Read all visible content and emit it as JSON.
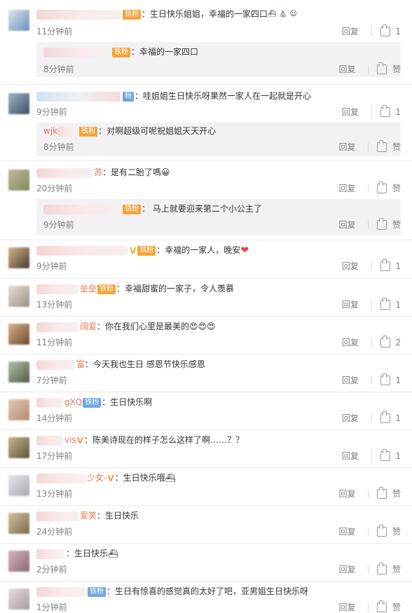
{
  "actions": {
    "reply": "回复",
    "like": "赞"
  },
  "comments": [
    {
      "name_tail": "",
      "badge": "铁粉",
      "text": "：生日快乐姐姐，幸福的一家四口",
      "suffix": "⛴ ⛪ ☺",
      "time": "11分钟前",
      "likes": "1",
      "replies": [
        {
          "name_tail": "",
          "badge": "铁粉",
          "text": "：幸福的一家四口",
          "time": "8分钟前",
          "likes": "赞"
        }
      ]
    },
    {
      "name_tail": "",
      "badge": "粉",
      "text": "：哇姐姐生日快乐呀果然一家人在一起就是开心",
      "time": "9分钟前",
      "likes": "1",
      "replies": [
        {
          "name_tail": "wjk",
          "badge": "铁粉",
          "text": "：对啊超级可呢祝姐姐天天开心",
          "time": "8分钟前",
          "likes": "赞"
        }
      ]
    },
    {
      "name_tail": "苏",
      "text": "：是有二胎了嗎😀",
      "time": "20分钟前",
      "likes": "赞",
      "replies": [
        {
          "name_tail": "",
          "badge": "铁粉",
          "text": "： 马上就要迎来第二个小公主了",
          "time": "9分钟前",
          "likes": "赞"
        }
      ]
    },
    {
      "name_tail": "",
      "badge": "铁粉",
      "vip": "V",
      "text": "：幸福的一家人，晚安",
      "suffix": "❤",
      "time": "9分钟前",
      "likes": "1"
    },
    {
      "name_tail": "垒垒",
      "badge": "铁粉",
      "text": "：幸福甜蜜的一家子，令人羡慕",
      "time": "13分钟前",
      "likes": "1"
    },
    {
      "name_tail": "阔爱",
      "text": "：你在我们心里是最美的😍😍😍",
      "time": "11分钟前",
      "likes": "2"
    },
    {
      "name_tail": "富",
      "text": "：今天我也生日  感恩节快乐感恩",
      "time": "7分钟前",
      "likes": "1"
    },
    {
      "name_tail": "gXQ",
      "badge": "铁粉",
      "text": "：生日快乐啊",
      "time": "14分钟前",
      "likes": "1"
    },
    {
      "name_tail": "vis",
      "vip": "V",
      "text": "：陈美诗现在的样子怎么这样了啊……？？",
      "time": "17分钟前",
      "likes": "1"
    },
    {
      "name_tail": "少女-",
      "vip": "V",
      "text": "：生日快乐哦⛴",
      "time": "13分钟前",
      "likes": "赞"
    },
    {
      "name_tail": "爱笑",
      "text": "：生日快乐",
      "time": "24分钟前",
      "likes": "赞"
    },
    {
      "name_tail": "",
      "text": "：生日快乐⛴",
      "time": "2分钟前",
      "likes": "赞"
    },
    {
      "name_tail": "",
      "badge": "铁粉",
      "text": "：生日有惊喜的感觉真的太好了吧，亚男姐生日快乐呀",
      "time": "1分钟前",
      "likes": "赞"
    }
  ]
}
